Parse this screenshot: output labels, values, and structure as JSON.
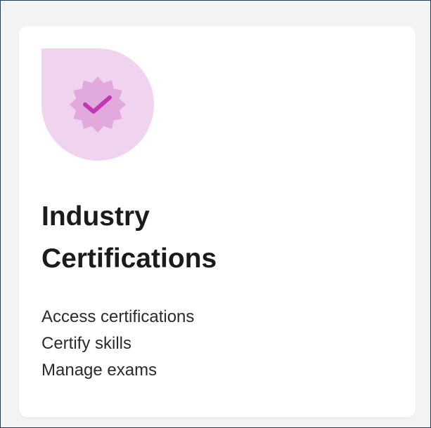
{
  "card": {
    "title_line1": "Industry",
    "title_line2": "Certifications",
    "links": [
      "Access certifications",
      "Certify skills",
      "Manage exams"
    ]
  },
  "icon": {
    "name": "certified-badge-icon",
    "shape_color": "#f0d3ef",
    "badge_color": "#e2a9dd",
    "check_color": "#c238b4"
  }
}
